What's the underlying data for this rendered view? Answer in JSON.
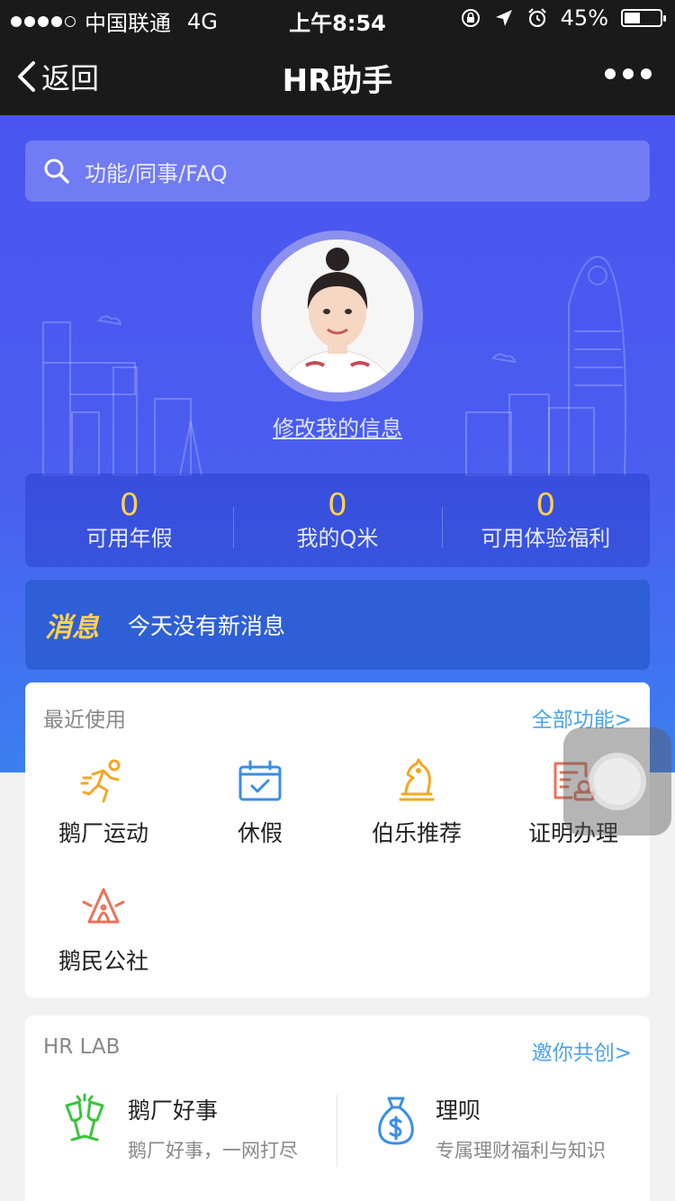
{
  "status": {
    "carrier": "中国联通",
    "network": "4G",
    "time": "上午8:54",
    "battery": "45%",
    "battery_level": 0.45
  },
  "nav": {
    "back_label": "返回",
    "title": "HR助手"
  },
  "search": {
    "placeholder": "功能/同事/FAQ"
  },
  "profile": {
    "edit_label": "修改我的信息"
  },
  "stats": [
    {
      "value": "0",
      "label": "可用年假"
    },
    {
      "value": "0",
      "label": "我的Q米"
    },
    {
      "value": "0",
      "label": "可用体验福利"
    }
  ],
  "message": {
    "tag": "消息",
    "text": "今天没有新消息"
  },
  "recent": {
    "title": "最近使用",
    "link": "全部功能>",
    "items": [
      {
        "label": "鹅厂运动",
        "icon": "running-icon"
      },
      {
        "label": "休假",
        "icon": "calendar-icon"
      },
      {
        "label": "伯乐推荐",
        "icon": "chess-knight-icon"
      },
      {
        "label": "证明办理",
        "icon": "certificate-icon"
      },
      {
        "label": "鹅民公社",
        "icon": "community-icon"
      }
    ]
  },
  "lab": {
    "title": "HR LAB",
    "link": "邀你共创>",
    "items": [
      {
        "title": "鹅厂好事",
        "subtitle": "鹅厂好事，一网打尽",
        "icon": "cheers-icon"
      },
      {
        "title": "理呗",
        "subtitle": "专属理财福利与知识",
        "icon": "money-bag-icon"
      }
    ]
  },
  "colors": {
    "accent_yellow": "#ffd24a",
    "link_blue": "#4aa3f0",
    "icon_orange": "#f5a623",
    "icon_blue": "#3a8ee6",
    "icon_red": "#e8735a",
    "icon_green": "#3cc43c"
  }
}
